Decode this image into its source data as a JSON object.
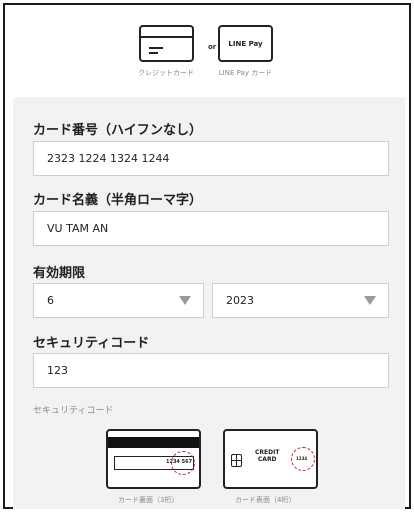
{
  "payment_options": {
    "credit_card_label": "クレジットカード",
    "or_label": "or",
    "linepay_logo_text": "LINE Pay",
    "linepay_label": "LINE Pay カード"
  },
  "form": {
    "card_number": {
      "label": "カード番号（ハイフンなし）",
      "value": "2323 1224 1324 1244"
    },
    "card_name": {
      "label": "カード名義（半角ローマ字）",
      "value": "VU TAM AN"
    },
    "expiry": {
      "label": "有効期限",
      "month": "6",
      "year": "2023"
    },
    "security_code": {
      "label": "セキュリティコード",
      "value": "123"
    }
  },
  "security_hint": {
    "title": "セキュリティコード",
    "back_card_number": "1234 567",
    "back_label": "カード裏面（3桁）",
    "front_card_text_line1": "CREDIT",
    "front_card_text_line2": "CARD",
    "front_card_code": "1234",
    "front_label": "カード表面（4桁）"
  }
}
